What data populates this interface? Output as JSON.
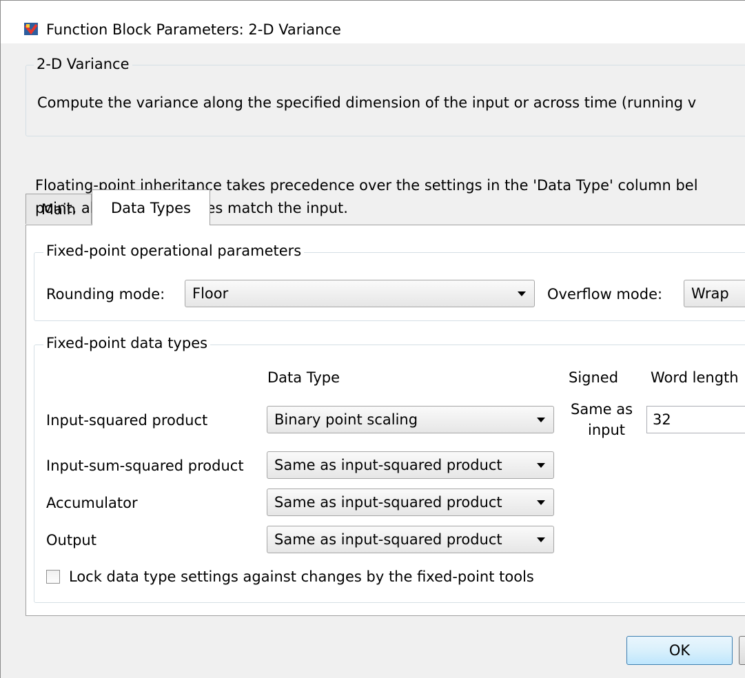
{
  "window": {
    "title": "Function Block Parameters: 2-D Variance"
  },
  "block": {
    "name": "2-D Variance",
    "description": "Compute the variance along the specified dimension of the input or across time (running v"
  },
  "tabs": [
    {
      "label": "Main",
      "selected": false
    },
    {
      "label": "Data Types",
      "selected": true
    }
  ],
  "data_types_tab": {
    "info_line1": "Floating-point inheritance takes precedence over the settings in the 'Data Type' column bel",
    "info_line2": "point, all block data types match the input.",
    "operational": {
      "legend": "Fixed-point operational parameters",
      "rounding_label": "Rounding mode:",
      "rounding_value": "Floor",
      "overflow_label": "Overflow mode:",
      "overflow_value": "Wrap"
    },
    "fixed_types": {
      "legend": "Fixed-point data types",
      "col_data_type": "Data Type",
      "col_signed": "Signed",
      "col_word_length": "Word length",
      "rows": [
        {
          "label": "Input-squared product",
          "data_type": "Binary point scaling",
          "signed_line1": "Same as",
          "signed_line2": "input",
          "word_length": "32"
        },
        {
          "label": "Input-sum-squared product",
          "data_type": "Same as input-squared product"
        },
        {
          "label": "Accumulator",
          "data_type": "Same as input-squared product"
        },
        {
          "label": "Output",
          "data_type": "Same as input-squared product"
        }
      ]
    },
    "lock_checkbox": {
      "label": "Lock data type settings against changes by the fixed-point tools",
      "checked": false
    }
  },
  "buttons": {
    "ok": "OK",
    "cancel": ""
  }
}
